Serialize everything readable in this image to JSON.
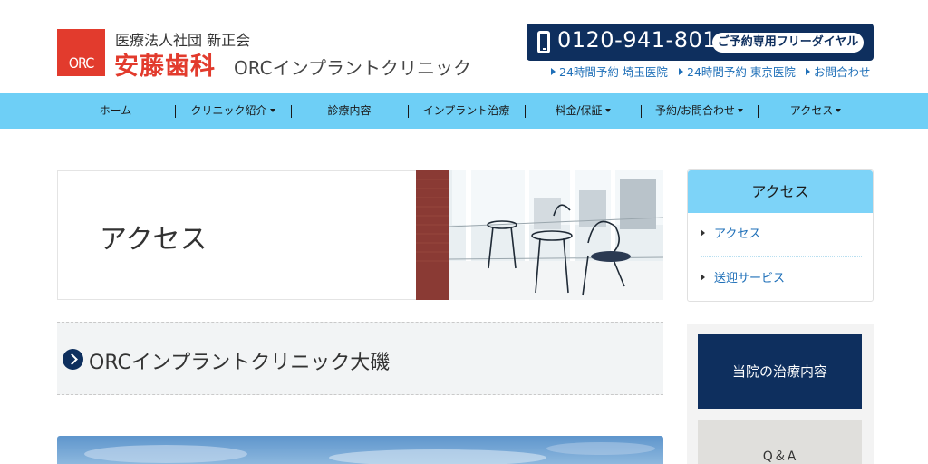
{
  "header": {
    "logo_text": "ORC",
    "org_name": "医療法人社団 新正会",
    "clinic_name_jp": "安藤歯科",
    "clinic_name_en": "ORCインプラントクリニック",
    "phone_number": "0120-941-801",
    "phone_label": "ご予約専用フリーダイヤル",
    "sublinks": [
      "24時間予約 埼玉医院",
      "24時間予約 東京医院",
      "お問合わせ"
    ],
    "colors": {
      "brand_red": "#e23b2d",
      "navy": "#0e2f5e",
      "nav_blue": "#6ecff6"
    }
  },
  "nav": {
    "items": [
      {
        "label": "ホーム",
        "dropdown": false
      },
      {
        "label": "クリニック紹介",
        "dropdown": true
      },
      {
        "label": "診療内容",
        "dropdown": false
      },
      {
        "label": "インプラント治療",
        "dropdown": false
      },
      {
        "label": "料金/保証",
        "dropdown": true
      },
      {
        "label": "予約/お問合わせ",
        "dropdown": true
      },
      {
        "label": "アクセス",
        "dropdown": true
      }
    ]
  },
  "main": {
    "page_title": "アクセス",
    "section_title": "ORCインプラントクリニック大磯"
  },
  "sidebar": {
    "heading": "アクセス",
    "links": [
      "アクセス",
      "送迎サービス"
    ],
    "banners": [
      "当院の治療内容",
      "Q＆A"
    ]
  }
}
